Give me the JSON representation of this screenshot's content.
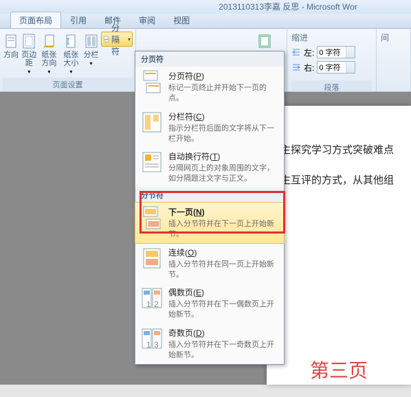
{
  "window": {
    "title": "2013110313李嘉 反思 - Microsoft Wor"
  },
  "tabs": {
    "items": [
      "页面布局",
      "引用",
      "邮件",
      "审阅",
      "视图"
    ],
    "active": 0
  },
  "ribbon": {
    "page_setup": {
      "orientation_partial": "方向",
      "margins": "页边距",
      "paper_orientation": "纸张方向",
      "paper_size": "纸张大小",
      "columns": "分栏",
      "breaks": "分隔符",
      "group_label": "页面设置"
    },
    "page_bg": {
      "border": "页面边框"
    },
    "indent": {
      "header": "缩进",
      "left_label": "左:",
      "left_value": "0 字符",
      "right_label": "右:",
      "right_value": "0 字符"
    },
    "spacing": {
      "header": "间"
    },
    "paragraph_label": "段落"
  },
  "dropdown": {
    "section1_header": "分页符",
    "page_break": {
      "title_pre": "分页符(",
      "key": "P",
      "title_post": ")",
      "desc": "标记一页终止并开始下一页的点。"
    },
    "column_break": {
      "title_pre": "分栏符(",
      "key": "C",
      "title_post": ")",
      "desc": "指示分栏符后面的文字将从下一栏开始。"
    },
    "text_wrap": {
      "title_pre": "自动换行符(",
      "key": "T",
      "title_post": ")",
      "desc": "分隔网页上的对象周围的文字，如分隔题注文字与正文。"
    },
    "section2_header": "分节符",
    "next_page": {
      "title_pre": "下一页(",
      "key": "N",
      "title_post": ")",
      "desc": "插入分节符并在下一页上开始新节。"
    },
    "continuous": {
      "title_pre": "连续(",
      "key": "O",
      "title_post": ")",
      "desc": "插入分节符并在同一页上开始新节。"
    },
    "even_page": {
      "title_pre": "偶数页(",
      "key": "E",
      "title_post": ")",
      "desc": "插入分节符并在下一偶数页上开始新节。"
    },
    "odd_page": {
      "title_pre": "奇数页(",
      "key": "D",
      "title_post": ")",
      "desc": "插入分节符并在下一奇数页上开始新节。"
    }
  },
  "document": {
    "line1": "主探究学习方式突破难点",
    "line2": "生互评的方式，从其他组",
    "page_label": "第三页"
  }
}
